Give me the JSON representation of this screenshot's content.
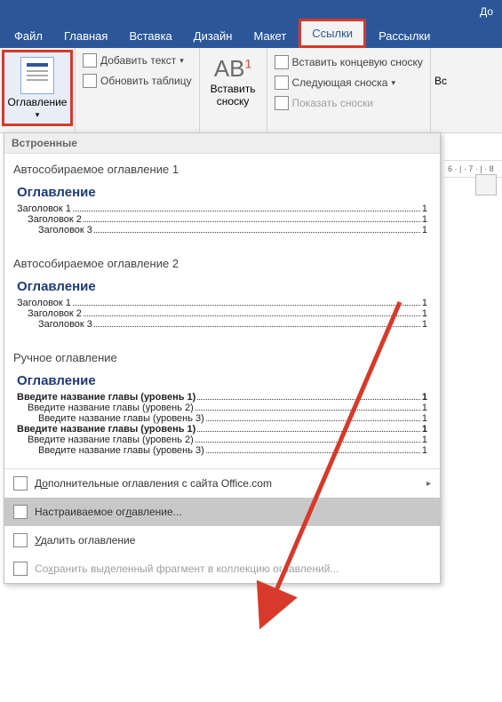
{
  "titlebar": {
    "doc_prefix": "До"
  },
  "tabs": {
    "file": "Файл",
    "home": "Главная",
    "insert": "Вставка",
    "design": "Дизайн",
    "layout": "Макет",
    "references": "Ссылки",
    "mailings": "Рассылки"
  },
  "ribbon": {
    "toc_label": "Оглавление",
    "add_text": "Добавить текст",
    "update_table": "Обновить таблицу",
    "insert_footnote_top": "Вставить",
    "insert_footnote_bottom": "сноску",
    "ab_label": "AB",
    "insert_endnote": "Вставить концевую сноску",
    "next_footnote": "Следующая сноска",
    "show_footnotes": "Показать сноски",
    "insert_right": "Вс"
  },
  "gallery": {
    "builtin_header": "Встроенные",
    "auto1_title": "Автособираемое оглавление 1",
    "auto2_title": "Автособираемое оглавление 2",
    "manual_title": "Ручное оглавление",
    "preview": {
      "title": "Оглавление",
      "h1": "Заголовок 1",
      "h2": "Заголовок 2",
      "h3": "Заголовок 3",
      "pg": "1",
      "m_h1a": "Введите название главы (уровень 1)",
      "m_h2": "Введите название главы (уровень 2)",
      "m_h3": "Введите название главы (уровень 3)",
      "m_h1b": "Введите название главы (уровень 1)"
    },
    "footer": {
      "more_pre": "Д",
      "more_acc": "о",
      "more_post": "полнительные оглавления с сайта Office.com",
      "custom_pre": "Настраиваемое ог",
      "custom_acc": "л",
      "custom_post": "авление...",
      "remove_pre": "",
      "remove_acc": "У",
      "remove_post": "далить оглавление",
      "save_pre": "Со",
      "save_acc": "х",
      "save_post": "ранить выделенный фрагмент в коллекцию оглавлений..."
    }
  },
  "ruler": {
    "marks": "6 · | · 7 · | · 8"
  }
}
